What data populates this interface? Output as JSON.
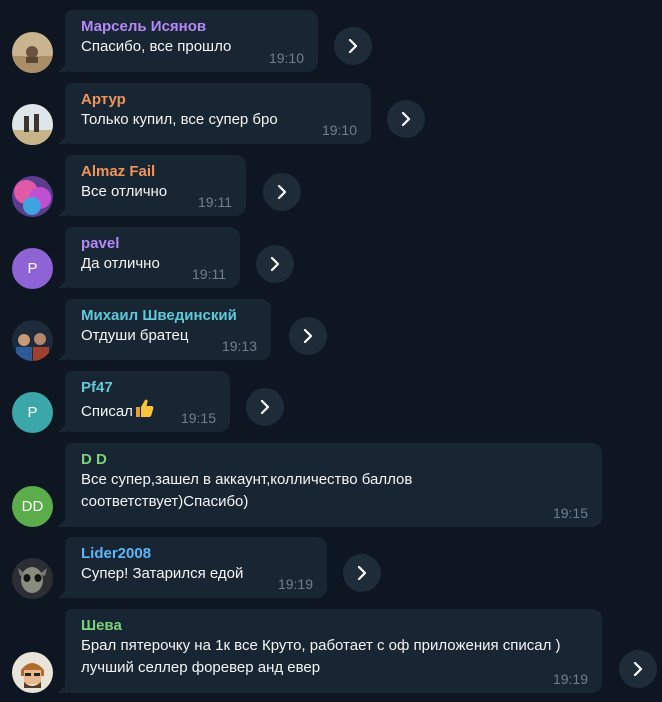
{
  "colors": {
    "background": "#0e1621",
    "bubble": "#182533",
    "time": "#6d7f8f"
  },
  "messages": [
    {
      "sender": "Марсель Исянов",
      "sender_color": "#b38af5",
      "text": "Спасибо, все прошло",
      "time": "19:10",
      "avatar": "photo-sand"
    },
    {
      "sender": "Артур",
      "sender_color": "#f0945a",
      "text": "Только купил, все супер бро",
      "time": "19:10",
      "avatar": "photo-beach"
    },
    {
      "sender": "Almaz Fail",
      "sender_color": "#f0945a",
      "text": "Все отлично",
      "time": "19:11",
      "avatar": "photo-pink-cloud"
    },
    {
      "sender": "pavel",
      "sender_color": "#b38af5",
      "text": "Да отлично",
      "time": "19:11",
      "avatar": "initial",
      "avatar_initial": "P",
      "avatar_color": "#8e63d6"
    },
    {
      "sender": "Михаил Швединский",
      "sender_color": "#5fc9d8",
      "text": "Отдуши братец",
      "time": "19:13",
      "avatar": "photo-group"
    },
    {
      "sender": "Pf47",
      "sender_color": "#5fc9d8",
      "text": "Списал",
      "emoji": "thumbs-up-emoji",
      "time": "19:15",
      "avatar": "initial",
      "avatar_initial": "P",
      "avatar_color": "#3ba7a8"
    },
    {
      "sender": "D D",
      "sender_color": "#7ed07c",
      "text": "Все супер,зашел в аккаунт,колличество баллов соответствует)Спасибо)",
      "time": "19:15",
      "avatar": "initial",
      "avatar_initial": "DD",
      "avatar_color": "#5aad4a"
    },
    {
      "sender": "Lider2008",
      "sender_color": "#5eb5f7",
      "text": "Супер! Затарился едой",
      "time": "19:19",
      "avatar": "photo-creature"
    },
    {
      "sender": "Шева",
      "sender_color": "#7ed07c",
      "text": "Брал пятерочку на 1к все Круто, работает с оф приложения списал ) лучший селлер форевер анд евер",
      "time": "19:19",
      "avatar": "photo-cartoon"
    }
  ]
}
